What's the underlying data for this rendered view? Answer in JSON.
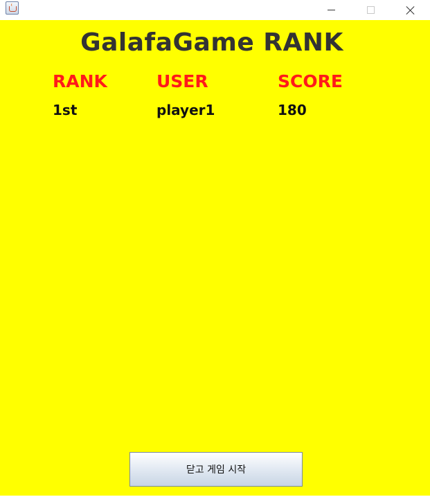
{
  "window": {
    "icon": "java-cup-icon"
  },
  "ranking": {
    "title": "GalafaGame RANK",
    "headers": {
      "rank": "RANK",
      "user": "USER",
      "score": "SCORE"
    },
    "rows": [
      {
        "rank": "1st",
        "user": "player1",
        "score": "180"
      }
    ]
  },
  "button": {
    "label": "닫고 게임 시작"
  },
  "colors": {
    "background": "#ffff00",
    "header_text": "#ff1a1a",
    "title_text": "#333333"
  }
}
